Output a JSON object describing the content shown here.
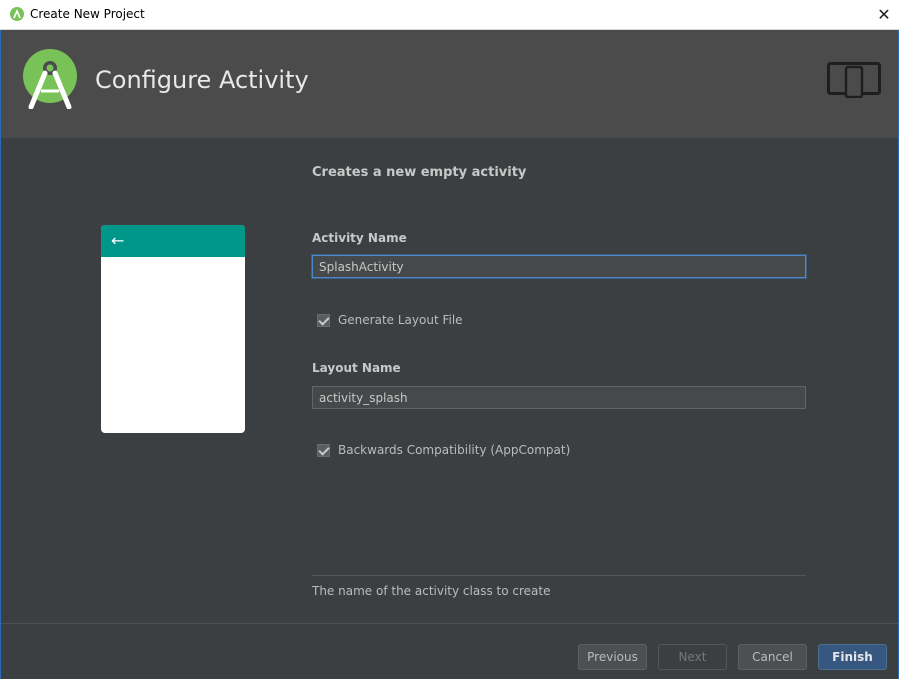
{
  "titlebar": {
    "title": "Create New Project",
    "close_glyph": "✕"
  },
  "header": {
    "title": "Configure Activity",
    "logo_icon": "android-studio-icon",
    "device_icon": "device-tablet-phone-icon"
  },
  "preview": {
    "back_glyph": "←",
    "toolbar_color": "#00968a"
  },
  "form": {
    "description": "Creates a new empty activity",
    "activity_name_label": "Activity Name",
    "activity_name_value": "SplashActivity",
    "generate_layout_label": "Generate Layout File",
    "generate_layout_checked": true,
    "layout_name_label": "Layout Name",
    "layout_name_value": "activity_splash",
    "backwards_compat_label": "Backwards Compatibility (AppCompat)",
    "backwards_compat_checked": true,
    "hint": "The name of the activity class to create"
  },
  "buttons": {
    "previous": "Previous",
    "next": "Next",
    "cancel": "Cancel",
    "finish": "Finish"
  },
  "colors": {
    "accent": "#4a88c7",
    "primary_button": "#365880",
    "android_green": "#78c257"
  }
}
